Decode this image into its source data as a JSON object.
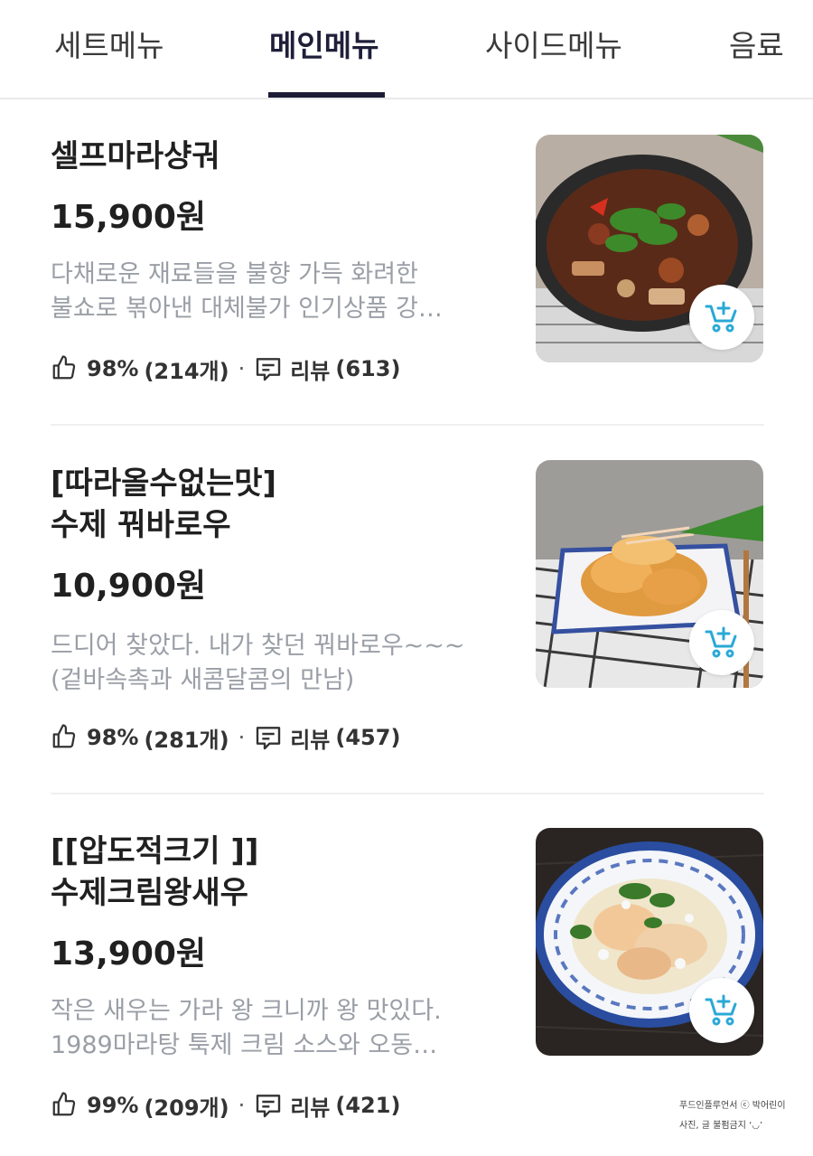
{
  "tabs": [
    {
      "label": "세트메뉴",
      "active": false
    },
    {
      "label": "메인메뉴",
      "active": true
    },
    {
      "label": "사이드메뉴",
      "active": false
    },
    {
      "label": "음료",
      "active": false
    }
  ],
  "items": [
    {
      "name_lines": [
        "셀프마라샹궈"
      ],
      "price": "15,900원",
      "desc_lines": [
        "다채로운 재료들을 불향 가득 화려한",
        "불쇼로 볶아낸 대체불가 인기상품 강…"
      ],
      "like_rate": "98%",
      "like_count": "(214개)",
      "dot": "·",
      "review_label": "리뷰",
      "review_count": "(613)",
      "icons": {
        "like": "thumbs-up-icon",
        "review": "speech-bubble-icon",
        "cart": "add-to-cart-icon"
      }
    },
    {
      "name_lines": [
        "[따라올수없는맛]",
        "수제 꿔바로우"
      ],
      "price": "10,900원",
      "desc_lines": [
        "드디어 찾았다. 내가 찾던 꿔바로우~~~",
        "(겉바속촉과 새콤달콤의 만남)"
      ],
      "like_rate": "98%",
      "like_count": "(281개)",
      "dot": "·",
      "review_label": "리뷰",
      "review_count": "(457)",
      "icons": {
        "like": "thumbs-up-icon",
        "review": "speech-bubble-icon",
        "cart": "add-to-cart-icon"
      }
    },
    {
      "name_lines": [
        "[[압도적크기 ]]",
        "수제크림왕새우"
      ],
      "price": "13,900원",
      "desc_lines": [
        "작은 새우는 가라 왕 크니까 왕 맛있다.",
        "1989마라탕 툭제 크림 소스와 오동…"
      ],
      "like_rate": "99%",
      "like_count": "(209개)",
      "dot": "·",
      "review_label": "리뷰",
      "review_count": "(421)",
      "icons": {
        "like": "thumbs-up-icon",
        "review": "speech-bubble-icon",
        "cart": "add-to-cart-icon"
      }
    }
  ],
  "watermark": {
    "line1": "푸드인플루언서 ⓒ 박어린이",
    "line2": "사진, 글 불펌금지 ‘◡’"
  },
  "colors": {
    "accent": "#1c1c36",
    "cart": "#29a9d6",
    "desc": "#9a9ea6"
  }
}
